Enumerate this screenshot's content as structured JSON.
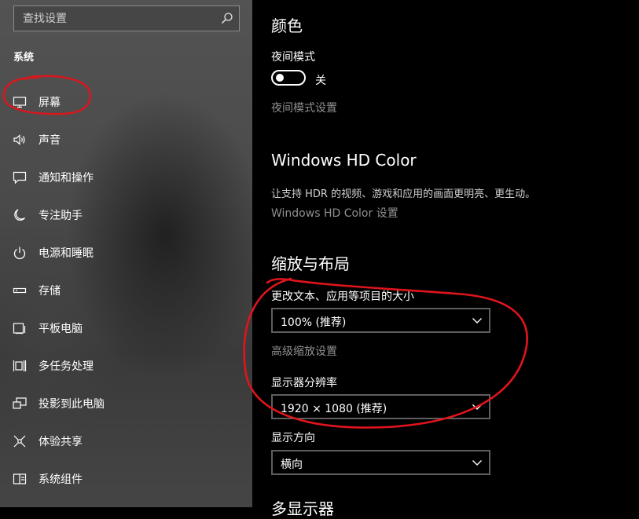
{
  "search": {
    "placeholder": "查找设置",
    "icon": "search-icon"
  },
  "sidebar": {
    "section_title": "系统",
    "items": [
      {
        "label": "屏幕",
        "icon": "monitor-icon"
      },
      {
        "label": "声音",
        "icon": "speaker-icon"
      },
      {
        "label": "通知和操作",
        "icon": "notification-icon"
      },
      {
        "label": "专注助手",
        "icon": "moon-icon"
      },
      {
        "label": "电源和睡眠",
        "icon": "power-icon"
      },
      {
        "label": "存储",
        "icon": "storage-icon"
      },
      {
        "label": "平板电脑",
        "icon": "tablet-icon"
      },
      {
        "label": "多任务处理",
        "icon": "multitask-icon"
      },
      {
        "label": "投影到此电脑",
        "icon": "project-icon"
      },
      {
        "label": "体验共享",
        "icon": "share-icon"
      },
      {
        "label": "系统组件",
        "icon": "components-icon"
      }
    ]
  },
  "main": {
    "color_title": "颜色",
    "night_mode_label": "夜间模式",
    "night_mode_state": "关",
    "night_mode_settings_link": "夜间模式设置",
    "hdr_title": "Windows HD Color",
    "hdr_description": "让支持 HDR 的视频、游戏和应用的画面更明亮、更生动。",
    "hdr_settings_link": "Windows HD Color 设置",
    "scale_title": "缩放与布局",
    "scale_label": "更改文本、应用等项目的大小",
    "scale_value": "100% (推荐)",
    "advanced_scale_link": "高级缩放设置",
    "resolution_label": "显示器分辨率",
    "resolution_value": "1920 × 1080 (推荐)",
    "orientation_label": "显示方向",
    "orientation_value": "横向",
    "multi_display_title": "多显示器"
  },
  "colors": {
    "background": "#000000",
    "secondary_text": "#8f8f8f",
    "annotation": "#e0141c"
  }
}
